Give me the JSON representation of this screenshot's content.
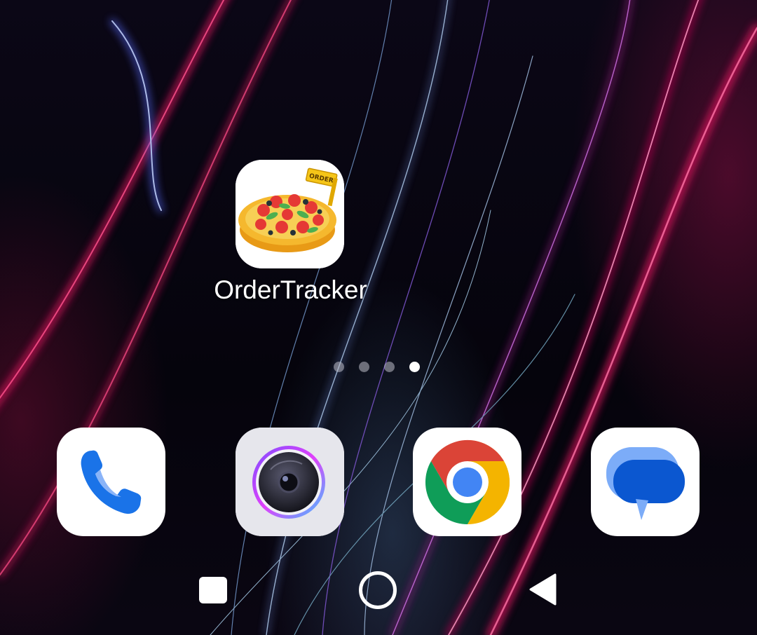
{
  "home_screen": {
    "apps": [
      {
        "label": "OrderTracker",
        "icon": "ordertracker-pizza-icon"
      }
    ],
    "page_indicator": {
      "total_pages": 4,
      "current_page": 4
    },
    "dock": [
      {
        "app": "Phone",
        "icon": "phone-icon"
      },
      {
        "app": "Camera",
        "icon": "camera-icon"
      },
      {
        "app": "Chrome",
        "icon": "chrome-icon"
      },
      {
        "app": "Messages",
        "icon": "messages-icon"
      }
    ],
    "order_badge_text": "ORDER"
  },
  "nav_bar": {
    "buttons": [
      "recents",
      "home",
      "back"
    ]
  },
  "colors": {
    "phone_blue": "#1a73e8",
    "chrome_red": "#db4437",
    "chrome_yellow": "#f4b400",
    "chrome_green": "#0f9d58",
    "chrome_blue": "#4285f4",
    "messages_blue": "#0b57d0",
    "messages_light": "#7cacf8",
    "pizza_crust": "#f5b82e",
    "tomato": "#e53935"
  }
}
